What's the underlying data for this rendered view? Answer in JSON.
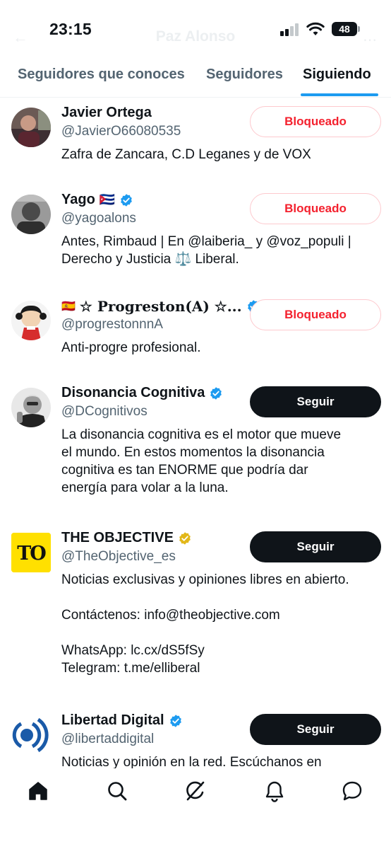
{
  "status_bar": {
    "time": "23:15",
    "battery": "48"
  },
  "header_ghost": {
    "title": "Paz Alonso"
  },
  "tabs": [
    {
      "label": "Seguidores que conoces"
    },
    {
      "label": "Seguidores"
    },
    {
      "label": "Siguiendo"
    }
  ],
  "accent_color": "#1d9bf0",
  "users": [
    {
      "name": "Javier Ortega",
      "handle": "@JavierO66080535",
      "bio": "Zafra de Zancara, C.D Leganes y de VOX",
      "button": "Bloqueado",
      "verified": "none"
    },
    {
      "name": "Yago",
      "flag": "🇨🇺",
      "handle": "@yagoalons",
      "bio": "Antes, Rimbaud | En @laiberia_ y @voz_populi |\nDerecho y Justicia ⚖️ Liberal.",
      "button": "Bloqueado",
      "verified": "blue"
    },
    {
      "name_prefix_flag": "🇪🇸",
      "name": "☆ 𝐏𝐫𝐨𝐠𝐫𝐞𝐬𝐭𝐨𝐧(𝐀) ☆...",
      "handle": "@progrestonnnA",
      "bio": "Anti-progre profesional.",
      "button": "Bloqueado",
      "verified": "blue"
    },
    {
      "name": "Disonancia Cognitiva",
      "handle": "@DCognitivos",
      "bio": "La disonancia cognitiva es el motor que mueve\nel mundo. En estos momentos la disonancia\ncognitiva es tan ENORME que podría dar\nenergía para volar a la luna.",
      "button": "Seguir",
      "verified": "blue"
    },
    {
      "name": "THE OBJECTIVE",
      "handle": "@TheObjective_es",
      "bio": "Noticias exclusivas y opiniones libres en abierto.\n\nContáctenos: info@theobjective.com\n\nWhatsApp: lc.cx/dS5fSy\nTelegram: t.me/elliberal",
      "button": "Seguir",
      "verified": "gold",
      "avatar_text": "TO"
    },
    {
      "name": "Libertad Digital",
      "handle": "@libertaddigital",
      "bio": "Noticias y opinión en la red. Escúchanos en",
      "button": "Seguir",
      "verified": "blue"
    }
  ],
  "bottom_nav": [
    {
      "icon": "home-icon"
    },
    {
      "icon": "search-icon"
    },
    {
      "icon": "grok-icon"
    },
    {
      "icon": "notifications-icon"
    },
    {
      "icon": "messages-icon"
    }
  ]
}
